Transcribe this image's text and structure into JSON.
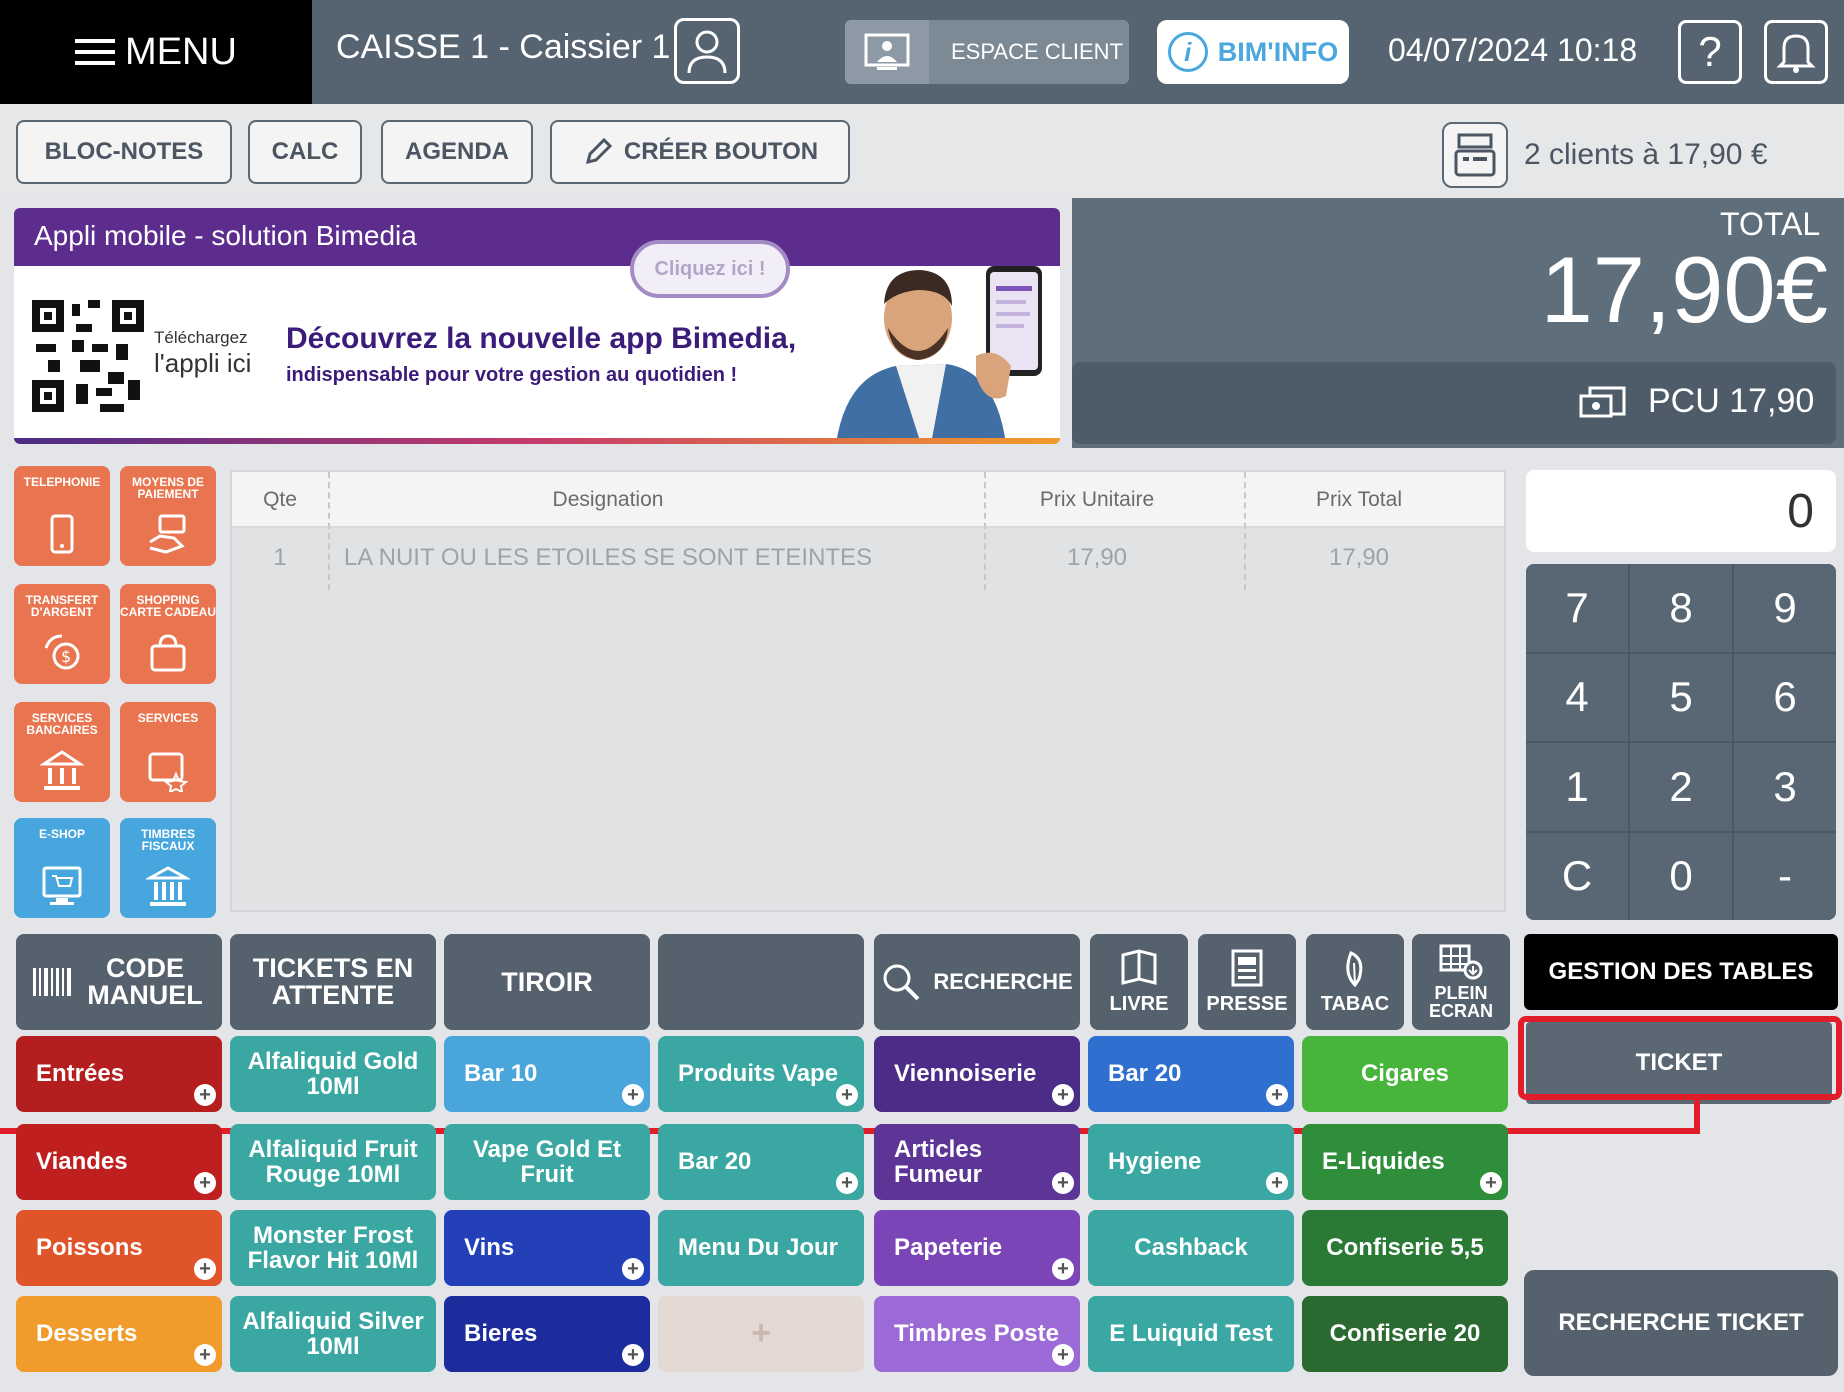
{
  "topbar": {
    "menu_label": "MENU",
    "caisse_label": "CAISSE 1 - Caissier 1",
    "espace_client_label": "ESPACE CLIENT",
    "bim_info_label": "BIM'INFO",
    "datetime": "04/07/2024 10:18",
    "help_label": "?"
  },
  "toolbar": {
    "buttons": [
      "BLOC-NOTES",
      "CALC",
      "AGENDA",
      "CRÉER BOUTON"
    ],
    "clients_text": "2 clients à 17,90 €"
  },
  "banner": {
    "header": "Appli mobile - solution Bimedia",
    "cta": "Cliquez ici !",
    "download_small": "Téléchargez",
    "download_big": "l'appli ici",
    "promo_title": "Découvrez la nouvelle app Bimedia,",
    "promo_subtitle": "indispensable pour votre gestion au quotidien !"
  },
  "totals": {
    "total_label": "TOTAL",
    "total_value": "17,90€",
    "pcu_text": "PCU 17,90"
  },
  "side_buttons": [
    {
      "label": "TELEPHONIE",
      "icon": "phone-icon",
      "color": "#e8754f"
    },
    {
      "label": "MOYENS DE PAIEMENT",
      "icon": "payment-hand-icon",
      "color": "#e8754f"
    },
    {
      "label": "TRANSFERT D'ARGENT",
      "icon": "money-transfer-icon",
      "color": "#e8754f"
    },
    {
      "label": "SHOPPING CARTE CADEAU",
      "icon": "gift-card-icon",
      "color": "#e8754f"
    },
    {
      "label": "SERVICES BANCAIRES",
      "icon": "bank-service-icon",
      "color": "#e8754f"
    },
    {
      "label": "SERVICES",
      "icon": "services-star-icon",
      "color": "#e8754f"
    },
    {
      "label": "E-SHOP",
      "icon": "eshop-cart-icon",
      "color": "#47a6de"
    },
    {
      "label": "TIMBRES FISCAUX",
      "icon": "government-building-icon",
      "color": "#47a6de"
    }
  ],
  "ticket_table": {
    "headers": [
      "Qte",
      "Designation",
      "Prix Unitaire",
      "Prix Total"
    ],
    "rows": [
      {
        "qte": "1",
        "designation": "LA NUIT OU LES ETOILES SE SONT ETEINTES",
        "prix_unitaire": "17,90",
        "prix_total": "17,90"
      }
    ]
  },
  "keypad": {
    "display": "0",
    "keys": [
      "7",
      "8",
      "9",
      "4",
      "5",
      "6",
      "1",
      "2",
      "3",
      "C",
      "0",
      "-"
    ]
  },
  "function_row": {
    "code_manuel": "CODE MANUEL",
    "tickets_attente": "TICKETS EN ATTENTE",
    "tiroir": "TIROIR",
    "recherche": "RECHERCHE",
    "livre": "LIVRE",
    "presse": "PRESSE",
    "tabac": "TABAC",
    "plein_ecran": "PLEIN ECRAN"
  },
  "right_actions": {
    "gestion_tables": "GESTION DES TABLES",
    "ticket": "TICKET",
    "recherche_ticket": "RECHERCHE TICKET"
  },
  "categories": [
    [
      {
        "label": "Entrées",
        "color": "#b51e1e",
        "plus": true
      },
      {
        "label": "Alfaliquid Gold 10Ml",
        "color": "#3aa7a3",
        "plus": false,
        "center": true
      },
      {
        "label": "Bar 10",
        "color": "#49a5da",
        "plus": true
      },
      {
        "label": "Produits Vape",
        "color": "#3aa7a3",
        "plus": true
      },
      {
        "label": "Viennoiserie",
        "color": "#4b2c86",
        "plus": true
      },
      {
        "label": "Bar 20",
        "color": "#2e6fcf",
        "plus": true
      },
      {
        "label": "Cigares",
        "color": "#47b53c",
        "plus": false,
        "center": true
      }
    ],
    [
      {
        "label": "Viandes",
        "color": "#c01f1f",
        "plus": true
      },
      {
        "label": "Alfaliquid Fruit Rouge 10Ml",
        "color": "#3aa7a3",
        "plus": false,
        "center": true
      },
      {
        "label": "Vape Gold Et Fruit",
        "color": "#3aa7a3",
        "plus": false,
        "center": true
      },
      {
        "label": "Bar 20",
        "color": "#3aa7a3",
        "plus": true
      },
      {
        "label": "Articles Fumeur",
        "color": "#5c3597",
        "plus": true
      },
      {
        "label": "Hygiene",
        "color": "#3aa7a3",
        "plus": true
      },
      {
        "label": "E-Liquides",
        "color": "#2f8e3a",
        "plus": true
      }
    ],
    [
      {
        "label": "Poissons",
        "color": "#e0542a",
        "plus": true
      },
      {
        "label": "Monster Frost Flavor Hit 10Ml",
        "color": "#3aa7a3",
        "plus": false,
        "center": true
      },
      {
        "label": "Vins",
        "color": "#2340b8",
        "plus": true
      },
      {
        "label": "Menu Du Jour",
        "color": "#3aa7a3",
        "plus": false
      },
      {
        "label": "Papeterie",
        "color": "#7b45b8",
        "plus": true
      },
      {
        "label": "Cashback",
        "color": "#3aa7a3",
        "plus": false,
        "center": true
      },
      {
        "label": "Confiserie 5,5",
        "color": "#2a7a36",
        "plus": false,
        "center": true
      }
    ],
    [
      {
        "label": "Desserts",
        "color": "#f19b2c",
        "plus": true
      },
      {
        "label": "Alfaliquid Silver 10Ml",
        "color": "#3aa7a3",
        "plus": false,
        "center": true
      },
      {
        "label": "Bieres",
        "color": "#1d2c9c",
        "plus": true
      },
      {
        "label": "+",
        "color": "#e3d8d2",
        "plus": false,
        "empty": true
      },
      {
        "label": "Timbres Poste",
        "color": "#9b6ad6",
        "plus": true
      },
      {
        "label": "E Luiquid Test",
        "color": "#3aa7a3",
        "plus": false,
        "center": true
      },
      {
        "label": "Confiserie 20",
        "color": "#2a6a30",
        "plus": false,
        "center": true
      }
    ]
  ]
}
